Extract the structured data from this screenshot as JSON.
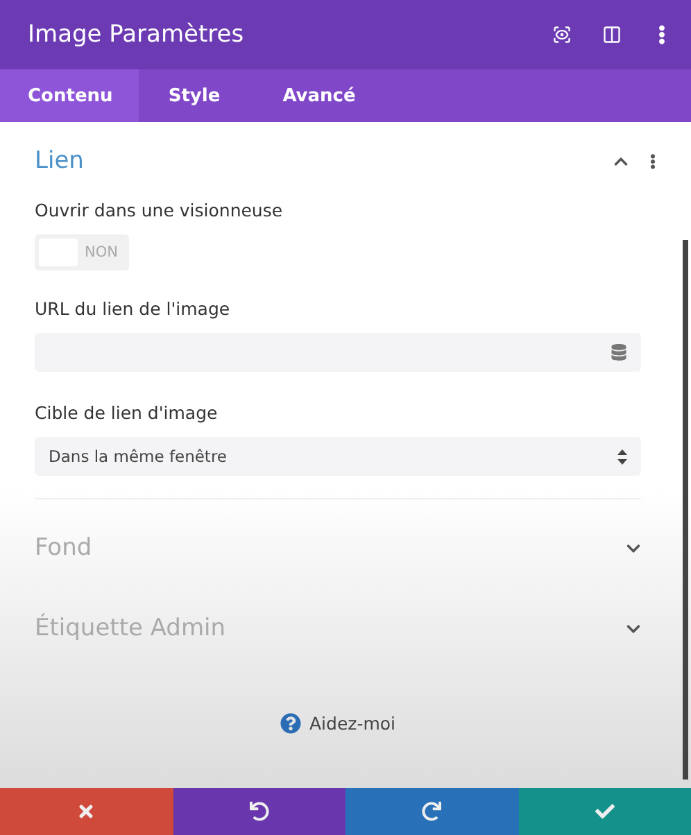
{
  "window": {
    "title": "Image Paramètres"
  },
  "tabs": [
    {
      "label": "Contenu",
      "selected": true
    },
    {
      "label": "Style",
      "selected": false
    },
    {
      "label": "Avancé",
      "selected": false
    }
  ],
  "sections": [
    {
      "title": "Lien",
      "expanded": true,
      "fields": [
        {
          "kind": "toggle",
          "label": "Ouvrir dans une visionneuse",
          "on": false,
          "state_text": "NON"
        },
        {
          "kind": "text",
          "label": "URL du lien de l'image"
        },
        {
          "kind": "select",
          "label": "Cible de lien d'image",
          "value": "Dans la même fenêtre"
        }
      ]
    },
    {
      "title": "Fond",
      "expanded": false
    },
    {
      "title": "Étiquette Admin",
      "expanded": false
    }
  ],
  "help": {
    "label": "Aidez-moi"
  },
  "footer": [
    {
      "kind": "cancel"
    },
    {
      "kind": "undo"
    },
    {
      "kind": "redo"
    },
    {
      "kind": "save"
    }
  ]
}
